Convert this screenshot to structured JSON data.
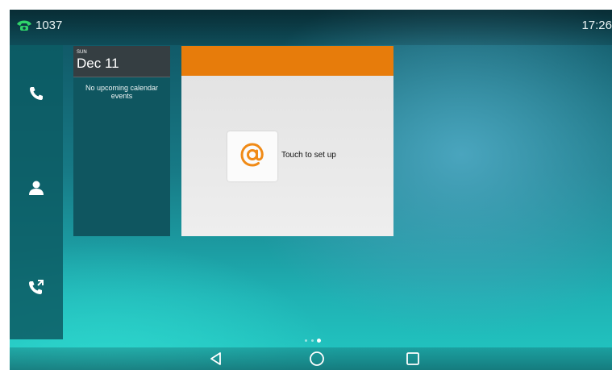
{
  "status_bar": {
    "extension": "1037",
    "time": "17:26",
    "line_icon": "phone-line-icon",
    "line_color": "#2fd46a"
  },
  "dock": {
    "items": [
      {
        "icon": "handset-icon",
        "label": "Call"
      },
      {
        "icon": "contact-icon",
        "label": "Directory"
      },
      {
        "icon": "call-history-icon",
        "label": "History"
      }
    ]
  },
  "calendar": {
    "day_of_week": "SUN",
    "date": "Dec 11",
    "empty_message": "No upcoming calendar events"
  },
  "email_widget": {
    "icon": "at-sign-icon",
    "setup_text": "Touch to set up",
    "accent": "#e77c0b"
  },
  "pager": {
    "pages": 3,
    "current": 3
  },
  "nav": {
    "back": "back-triangle-icon",
    "home": "home-circle-icon",
    "recents": "recents-square-icon"
  }
}
